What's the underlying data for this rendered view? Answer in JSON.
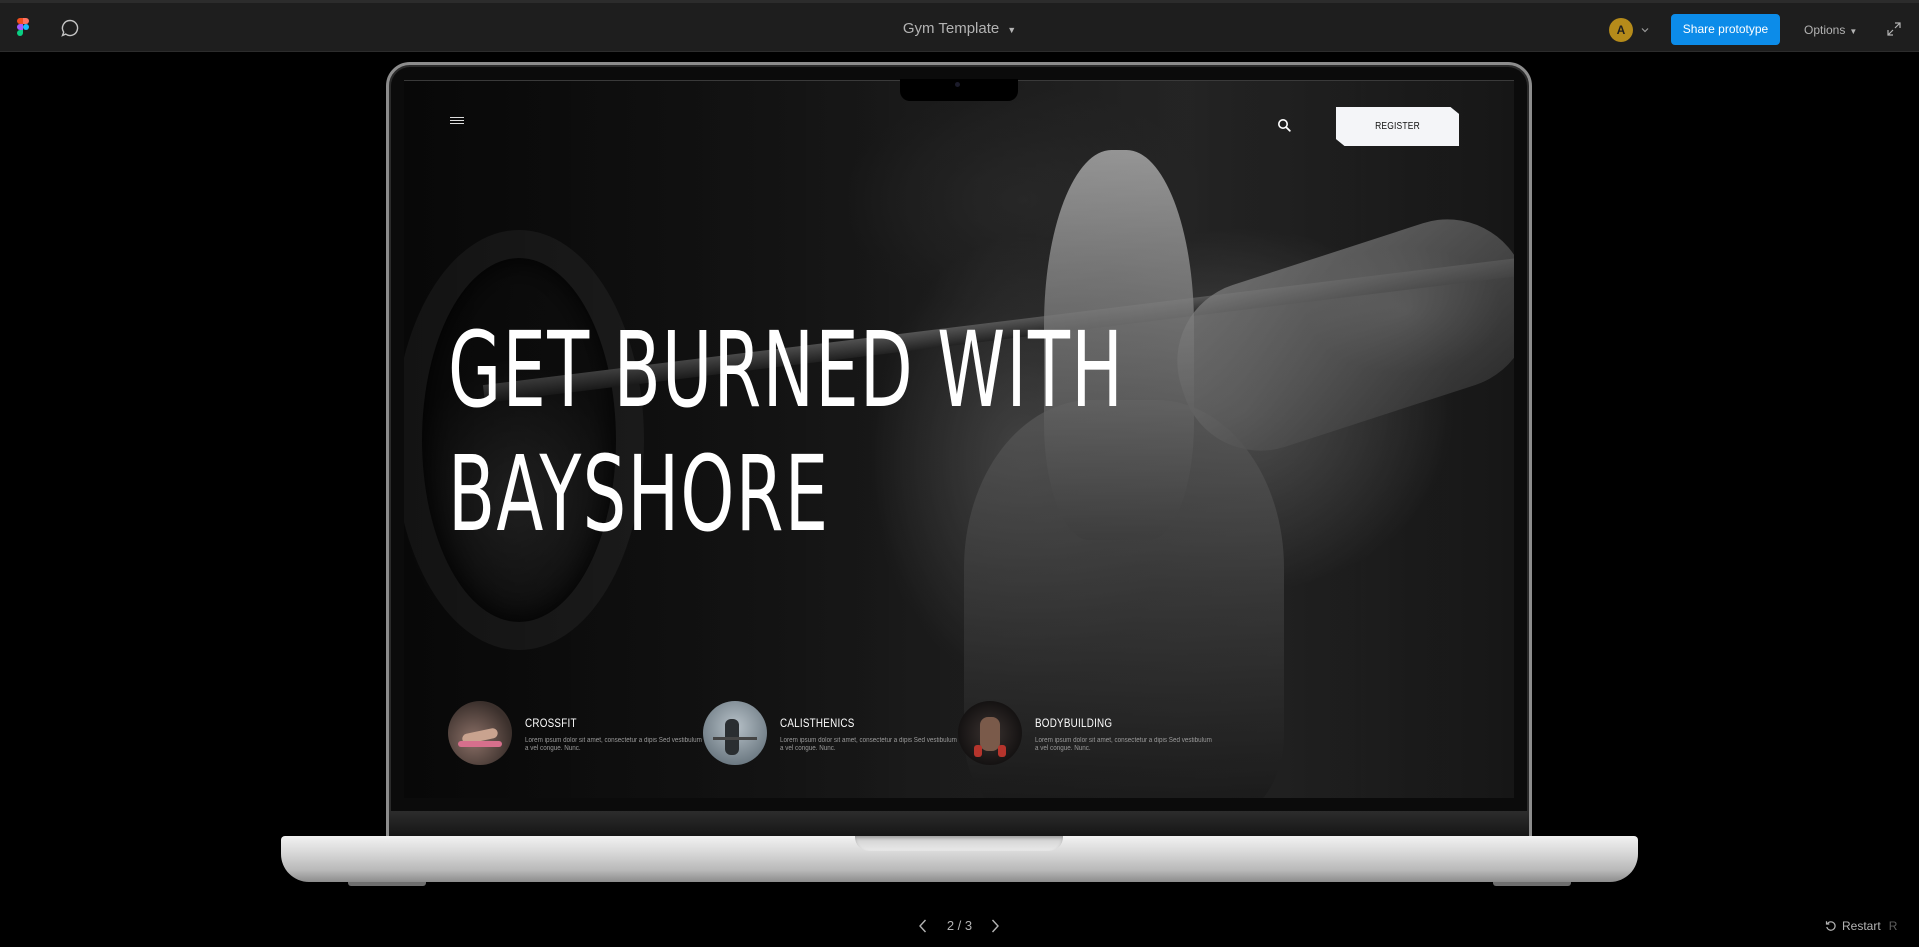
{
  "toolbar": {
    "app_icon": "figma-logo",
    "comment_icon": "comment-bubble-icon",
    "file_title": "Gym Template",
    "avatar_initial": "A",
    "share_label": "Share prototype",
    "options_label": "Options",
    "expand_icon": "expand-icon",
    "accent_color": "#0c8ce9"
  },
  "site": {
    "menu_icon": "hamburger-menu-icon",
    "search_icon": "search-icon",
    "register_label": "REGISTER",
    "hero_line_1": "GET BURNED WITH",
    "hero_line_2": "BAYSHORE",
    "programs": [
      {
        "title": "CROSSFIT",
        "description": "Lorem ipsum dolor sit amet, consectetur a dipis Sed vestibulum a vel congue. Nunc."
      },
      {
        "title": "CALISTHENICS",
        "description": "Lorem ipsum dolor sit amet, consectetur a dipis Sed vestibulum a vel congue. Nunc."
      },
      {
        "title": "BODYBUILDING",
        "description": "Lorem ipsum dolor sit amet, consectetur a dipis Sed vestibulum a vel congue. Nunc."
      }
    ]
  },
  "footer": {
    "page_indicator": "2 / 3",
    "restart_label": "Restart",
    "restart_shortcut": "R"
  }
}
